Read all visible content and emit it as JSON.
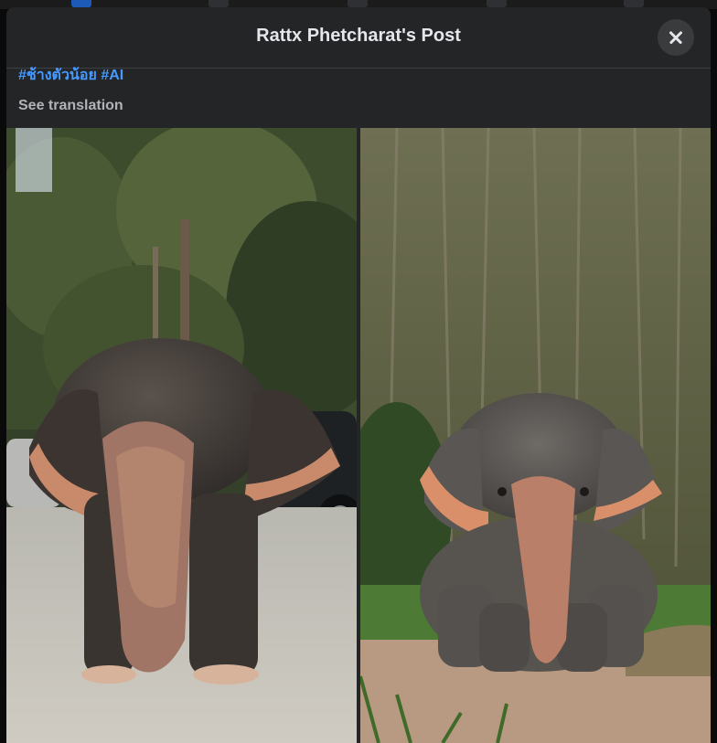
{
  "post": {
    "title": "Rattx Phetcharat's Post",
    "hashtags": [
      "#ช้างตัวน้อย",
      "#AI"
    ],
    "see_translation": "See translation"
  },
  "photos": [
    {
      "alt": "elephant-on-pavement-photo"
    },
    {
      "alt": "elephant-sitting-in-forest-photo"
    }
  ],
  "icons": {
    "close": "close-icon"
  },
  "colors": {
    "link": "#4599ff",
    "dialog_bg": "#242526",
    "text": "#e4e6eb",
    "muted": "#b0b3b8"
  }
}
